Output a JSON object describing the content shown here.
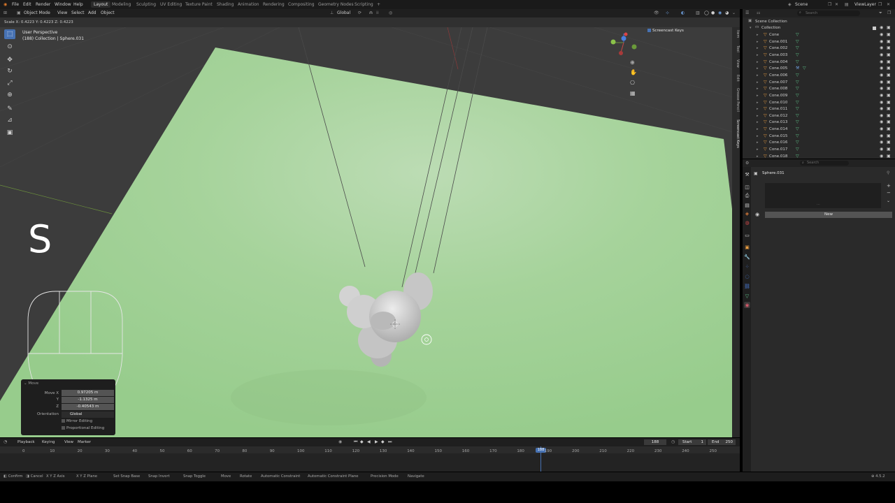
{
  "topbar": {
    "menus": [
      "File",
      "Edit",
      "Render",
      "Window",
      "Help"
    ],
    "workspaces": [
      "Layout",
      "Modeling",
      "Sculpting",
      "UV Editing",
      "Texture Paint",
      "Shading",
      "Animation",
      "Rendering",
      "Compositing",
      "Geometry Nodes",
      "Scripting"
    ],
    "active_workspace": "Layout",
    "scene_label": "Scene",
    "viewlayer_label": "ViewLayer"
  },
  "header": {
    "mode": "Object Mode",
    "menus": [
      "View",
      "Select",
      "Add",
      "Object"
    ],
    "orientation": "Global"
  },
  "status_line": "Scale X: 0.4223   Y: 0.4223   Z: 0.4223",
  "viewport": {
    "view_name": "User Perspective",
    "collection_info": "(188) Collection | Sphere.031",
    "key_overlay": "S",
    "screencast_label": "Screencast Keys",
    "side_tabs": [
      "Item",
      "Tool",
      "View",
      "Edit",
      "Grease Pencil",
      "Screencast Keys"
    ]
  },
  "operator_panel": {
    "title": "Move",
    "move_x_label": "Move X",
    "move_x": "0.97205 m",
    "y_label": "Y",
    "y": "-1.1325 m",
    "z_label": "Z",
    "z": "-0.40543 m",
    "orientation_label": "Orientation",
    "orientation": "Global",
    "mirror": "Mirror Editing",
    "proportional": "Proportional Editing"
  },
  "outliner": {
    "search_placeholder": "Search",
    "scene_collection": "Scene Collection",
    "collection": "Collection",
    "items": [
      "Cone",
      "Cone.001",
      "Cone.002",
      "Cone.003",
      "Cone.004",
      "Cone.005",
      "Cone.006",
      "Cone.007",
      "Cone.008",
      "Cone.009",
      "Cone.010",
      "Cone.011",
      "Cone.012",
      "Cone.013",
      "Cone.014",
      "Cone.015",
      "Cone.016",
      "Cone.017",
      "Cone.018"
    ]
  },
  "properties": {
    "search_placeholder": "Search",
    "object_name": "Sphere.031",
    "new_button": "New"
  },
  "timeline": {
    "menus": [
      "Playback",
      "Keying",
      "View",
      "Marker"
    ],
    "current_frame": "188",
    "start_label": "Start",
    "start": "1",
    "end_label": "End",
    "end": "250",
    "ticks": [
      "0",
      "10",
      "20",
      "30",
      "40",
      "50",
      "60",
      "70",
      "80",
      "90",
      "100",
      "110",
      "120",
      "130",
      "140",
      "150",
      "160",
      "170",
      "180",
      "190",
      "200",
      "210",
      "220",
      "230",
      "240",
      "250"
    ],
    "playhead": "188"
  },
  "statusbar": {
    "items": [
      "Confirm",
      "Cancel",
      "X Y Z Axis",
      "X Y Z Plane",
      "Set Snap Base",
      "Snap Invert",
      "Snap Toggle",
      "Move",
      "Rotate",
      "Automatic Constraint",
      "Automatic Constraint Plane",
      "Precision Mode",
      "Navigate"
    ],
    "version": "4.5.2"
  }
}
